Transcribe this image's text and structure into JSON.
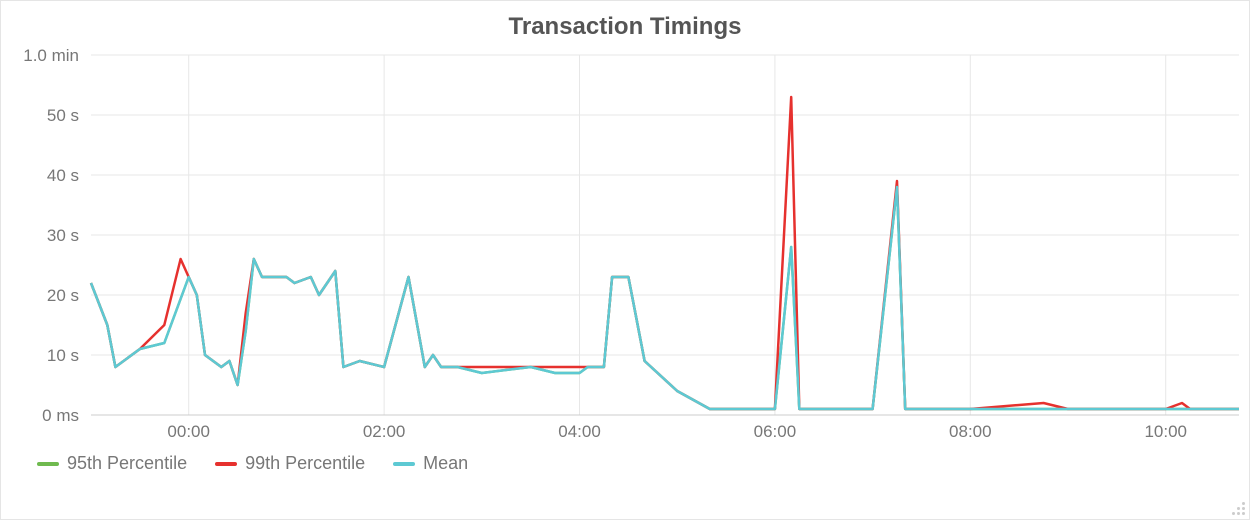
{
  "title": "Transaction Timings",
  "legend": {
    "series1": "95th Percentile",
    "series2": "99th Percentile",
    "series3": "Mean"
  },
  "chart_data": {
    "type": "line",
    "title": "Transaction Timings",
    "xlabel": "",
    "ylabel": "",
    "y_ticks": [
      "0 ms",
      "10 s",
      "20 s",
      "30 s",
      "40 s",
      "50 s",
      "1.0 min"
    ],
    "x_ticks": [
      "00:00",
      "02:00",
      "04:00",
      "06:00",
      "08:00",
      "10:00"
    ],
    "xlim": [
      "23:00",
      "10:45"
    ],
    "ylim_seconds": [
      0,
      60
    ],
    "series": [
      {
        "name": "95th Percentile",
        "color": "#6fba4f",
        "x": [
          "23:00",
          "23:10",
          "23:15",
          "23:30",
          "23:45",
          "00:00",
          "00:05",
          "00:10",
          "00:20",
          "00:25",
          "00:30",
          "00:35",
          "00:40",
          "00:45",
          "00:55",
          "01:00",
          "01:05",
          "01:15",
          "01:20",
          "01:30",
          "01:35",
          "01:45",
          "02:00",
          "02:15",
          "02:25",
          "02:30",
          "02:35",
          "02:45",
          "03:00",
          "03:30",
          "03:45",
          "04:00",
          "04:05",
          "04:15",
          "04:20",
          "04:30",
          "04:40",
          "05:00",
          "05:20",
          "05:45",
          "06:00",
          "06:10",
          "06:15",
          "06:20",
          "07:00",
          "07:15",
          "07:20",
          "07:30",
          "08:00",
          "09:00",
          "10:00",
          "10:15",
          "10:30",
          "10:45"
        ],
        "y_seconds": [
          22,
          15,
          8,
          11,
          12,
          23,
          20,
          10,
          8,
          9,
          5,
          14,
          26,
          23,
          23,
          23,
          22,
          23,
          20,
          24,
          8,
          9,
          8,
          23,
          8,
          10,
          8,
          8,
          7,
          8,
          7,
          7,
          8,
          8,
          23,
          23,
          9,
          4,
          1,
          1,
          1,
          28,
          1,
          1,
          1,
          38,
          1,
          1,
          1,
          1,
          1,
          1,
          1,
          1
        ]
      },
      {
        "name": "99th Percentile",
        "color": "#e6312e",
        "x": [
          "23:00",
          "23:10",
          "23:15",
          "23:30",
          "23:45",
          "23:55",
          "00:00",
          "00:05",
          "00:10",
          "00:20",
          "00:25",
          "00:30",
          "00:35",
          "00:40",
          "00:45",
          "00:55",
          "01:00",
          "01:05",
          "01:15",
          "01:20",
          "01:30",
          "01:35",
          "01:45",
          "02:00",
          "02:15",
          "02:25",
          "02:30",
          "02:35",
          "02:45",
          "03:00",
          "03:30",
          "03:45",
          "04:00",
          "04:05",
          "04:15",
          "04:20",
          "04:30",
          "04:40",
          "05:00",
          "05:20",
          "05:45",
          "06:00",
          "06:10",
          "06:15",
          "06:20",
          "07:00",
          "07:15",
          "07:20",
          "07:30",
          "08:00",
          "08:45",
          "09:00",
          "09:40",
          "10:00",
          "10:10",
          "10:15",
          "10:30",
          "10:45"
        ],
        "y_seconds": [
          22,
          15,
          8,
          11,
          15,
          26,
          23,
          20,
          10,
          8,
          9,
          5,
          17,
          26,
          23,
          23,
          23,
          22,
          23,
          20,
          24,
          8,
          9,
          8,
          23,
          8,
          10,
          8,
          8,
          8,
          8,
          8,
          8,
          8,
          8,
          23,
          23,
          9,
          4,
          1,
          1,
          1,
          53,
          1,
          1,
          1,
          39,
          1,
          1,
          1,
          2,
          1,
          1,
          1,
          2,
          1,
          1,
          1
        ]
      },
      {
        "name": "Mean",
        "color": "#5dc9d3",
        "x": [
          "23:00",
          "23:10",
          "23:15",
          "23:30",
          "23:45",
          "00:00",
          "00:05",
          "00:10",
          "00:20",
          "00:25",
          "00:30",
          "00:35",
          "00:40",
          "00:45",
          "00:55",
          "01:00",
          "01:05",
          "01:15",
          "01:20",
          "01:30",
          "01:35",
          "01:45",
          "02:00",
          "02:15",
          "02:25",
          "02:30",
          "02:35",
          "02:45",
          "03:00",
          "03:30",
          "03:45",
          "04:00",
          "04:05",
          "04:15",
          "04:20",
          "04:30",
          "04:40",
          "05:00",
          "05:20",
          "05:45",
          "06:00",
          "06:10",
          "06:15",
          "06:20",
          "07:00",
          "07:15",
          "07:20",
          "07:30",
          "08:00",
          "09:00",
          "10:00",
          "10:15",
          "10:30",
          "10:45"
        ],
        "y_seconds": [
          22,
          15,
          8,
          11,
          12,
          23,
          20,
          10,
          8,
          9,
          5,
          14,
          26,
          23,
          23,
          23,
          22,
          23,
          20,
          24,
          8,
          9,
          8,
          23,
          8,
          10,
          8,
          8,
          7,
          8,
          7,
          7,
          8,
          8,
          23,
          23,
          9,
          4,
          1,
          1,
          1,
          28,
          1,
          1,
          1,
          38,
          1,
          1,
          1,
          1,
          1,
          1,
          1,
          1
        ]
      }
    ]
  }
}
